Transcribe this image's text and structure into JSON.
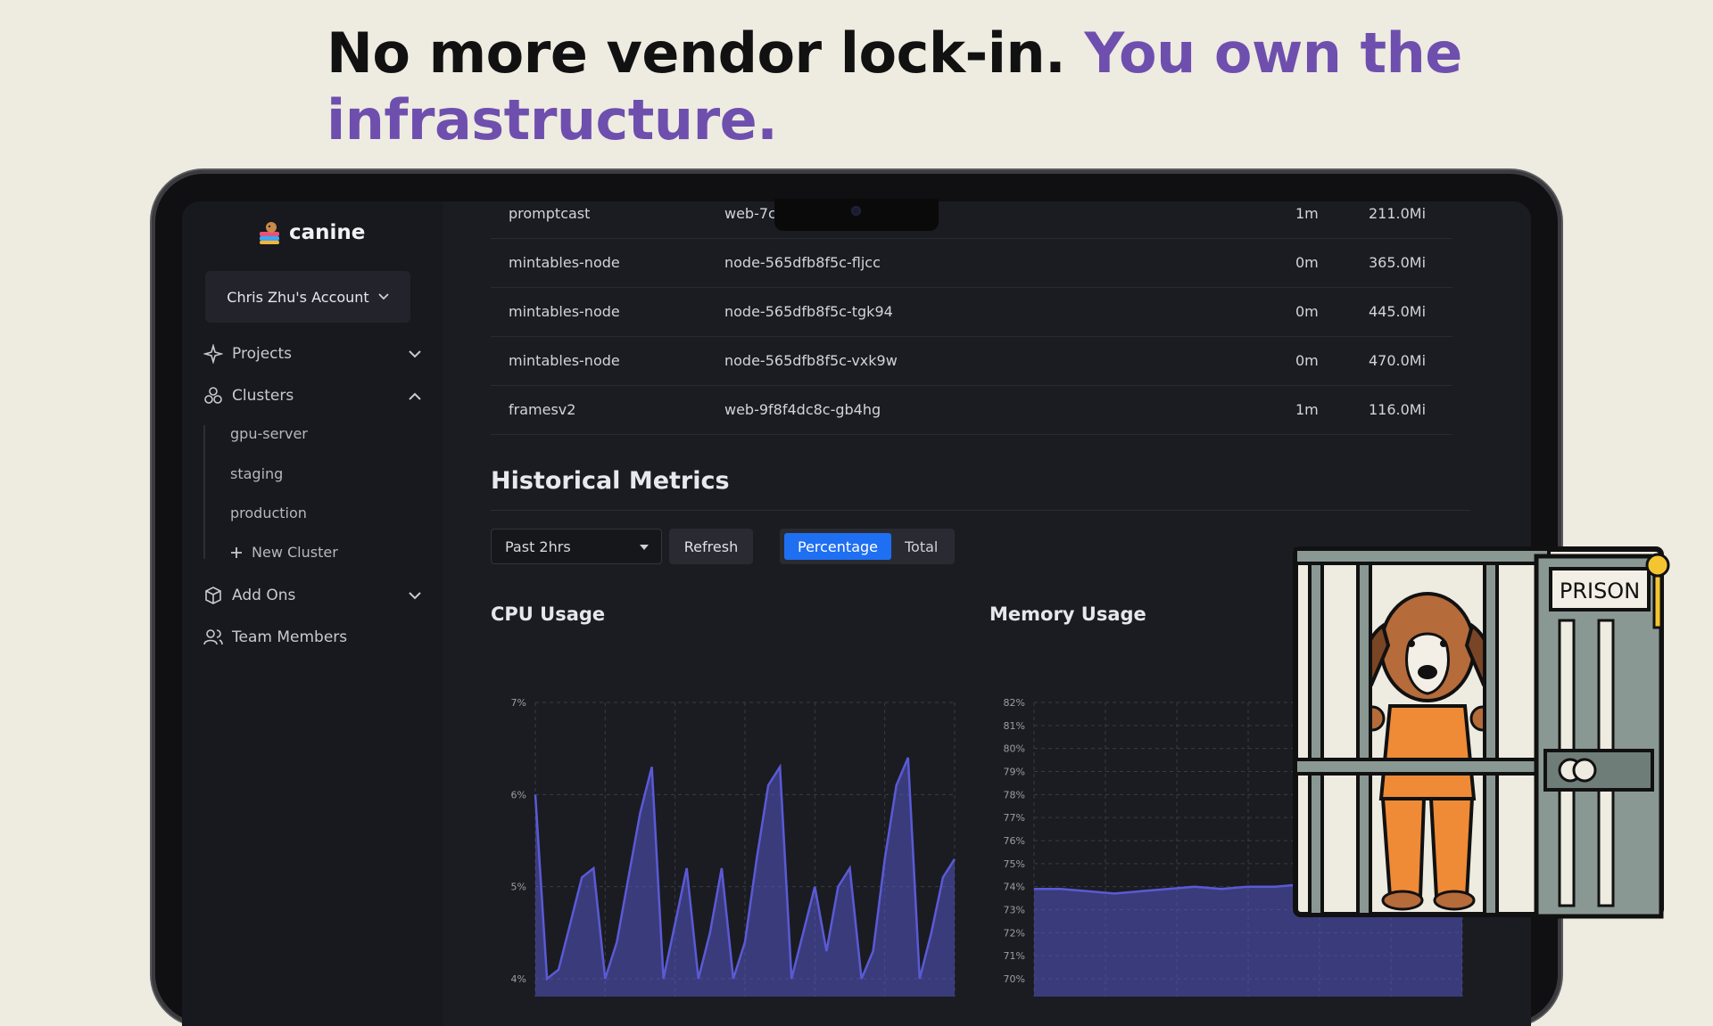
{
  "headline": {
    "text": "No more vendor lock-in.",
    "accent": "You own the infrastructure."
  },
  "sidebar": {
    "brand": "canine",
    "account": "Chris Zhu's Account",
    "nav": {
      "projects": "Projects",
      "clusters": "Clusters",
      "add_ons": "Add Ons",
      "team_members": "Team Members"
    },
    "clusters": [
      "gpu-server",
      "staging",
      "production"
    ],
    "new_cluster": "New Cluster"
  },
  "pods": [
    {
      "app": "promptcast",
      "pod": "web-7c",
      "cpu": "1m",
      "memory": "211.0Mi"
    },
    {
      "app": "mintables-node",
      "pod": "node-565dfb8f5c-fljcc",
      "cpu": "0m",
      "memory": "365.0Mi"
    },
    {
      "app": "mintables-node",
      "pod": "node-565dfb8f5c-tgk94",
      "cpu": "0m",
      "memory": "445.0Mi"
    },
    {
      "app": "mintables-node",
      "pod": "node-565dfb8f5c-vxk9w",
      "cpu": "0m",
      "memory": "470.0Mi"
    },
    {
      "app": "framesv2",
      "pod": "web-9f8f4dc8c-gb4hg",
      "cpu": "1m",
      "memory": "116.0Mi"
    }
  ],
  "metrics": {
    "title": "Historical Metrics",
    "range": "Past 2hrs",
    "refresh": "Refresh",
    "mode_on": "Percentage",
    "mode_off": "Total",
    "cpu_title": "CPU Usage",
    "memory_title": "Memory Usage"
  },
  "mascot": {
    "sign": "PRISON"
  },
  "colors": {
    "accent": "#6e4fae",
    "series": "#5a5ad6",
    "toggle_active": "#1f6ff2"
  },
  "chart_data": [
    {
      "type": "area",
      "title": "CPU Usage",
      "yticks": [
        "7%",
        "6%",
        "5%",
        "4%"
      ],
      "ylim": [
        4,
        7
      ],
      "x": [
        0,
        1,
        2,
        3,
        4,
        5,
        6,
        7,
        8,
        9,
        10,
        11,
        12,
        13,
        14,
        15,
        16,
        17,
        18,
        19,
        20,
        21,
        22,
        23,
        24,
        25,
        26,
        27,
        28,
        29,
        30,
        31,
        32,
        33,
        34,
        35,
        36
      ],
      "values": [
        6.0,
        4.0,
        4.1,
        4.6,
        5.1,
        5.2,
        4.0,
        4.4,
        5.1,
        5.8,
        6.3,
        4.0,
        4.6,
        5.2,
        4.0,
        4.5,
        5.2,
        4.0,
        4.4,
        5.3,
        6.1,
        6.3,
        4.0,
        4.5,
        5.0,
        4.3,
        5.0,
        5.2,
        4.0,
        4.3,
        5.3,
        6.1,
        6.4,
        4.0,
        4.5,
        5.1,
        5.3
      ]
    },
    {
      "type": "area",
      "title": "Memory Usage",
      "yticks": [
        "82%",
        "81%",
        "80%",
        "79%",
        "78%",
        "77%",
        "76%",
        "75%",
        "74%",
        "73%",
        "72%",
        "71%",
        "70%"
      ],
      "ylim": [
        70,
        82
      ],
      "x": [
        0,
        1,
        2,
        3,
        4,
        5,
        6,
        7,
        8,
        9,
        10,
        11,
        12,
        13,
        14,
        15,
        16
      ],
      "values": [
        73.9,
        73.9,
        73.8,
        73.7,
        73.8,
        73.9,
        74.0,
        73.9,
        74.0,
        74.0,
        74.1,
        74.0,
        74.0,
        74.1,
        74.0,
        74.2,
        74.1
      ]
    }
  ]
}
